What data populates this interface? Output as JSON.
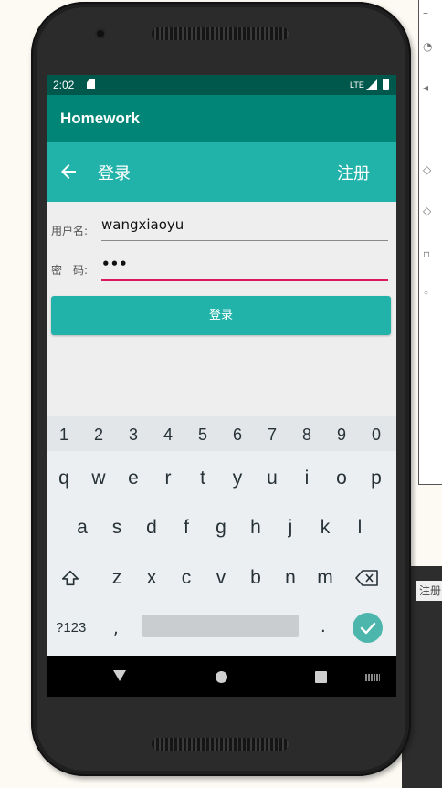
{
  "status_bar": {
    "time": "2:02",
    "network": "LTE"
  },
  "app_bar": {
    "title": "Homework"
  },
  "toolbar": {
    "title": "登录",
    "register_label": "注册"
  },
  "form": {
    "username_label": "用户名:",
    "username_value": "wangxiaoyu",
    "password_label": "密　码:",
    "password_value": "•••"
  },
  "login_button": {
    "label": "登录"
  },
  "keyboard": {
    "number_row": [
      "1",
      "2",
      "3",
      "4",
      "5",
      "6",
      "7",
      "8",
      "9",
      "0"
    ],
    "row1": [
      "q",
      "w",
      "e",
      "r",
      "t",
      "y",
      "u",
      "i",
      "o",
      "p"
    ],
    "row2": [
      "a",
      "s",
      "d",
      "f",
      "g",
      "h",
      "j",
      "k",
      "l"
    ],
    "row3": [
      "z",
      "x",
      "c",
      "v",
      "b",
      "n",
      "m"
    ],
    "symbols_label": "?123",
    "comma": ",",
    "period": "."
  },
  "background_window": {
    "partial_label": "注册"
  },
  "colors": {
    "status_bar": "#00574b",
    "app_bar": "#008577",
    "accent": "#21b3aa",
    "focus_underline": "#d81b60"
  }
}
